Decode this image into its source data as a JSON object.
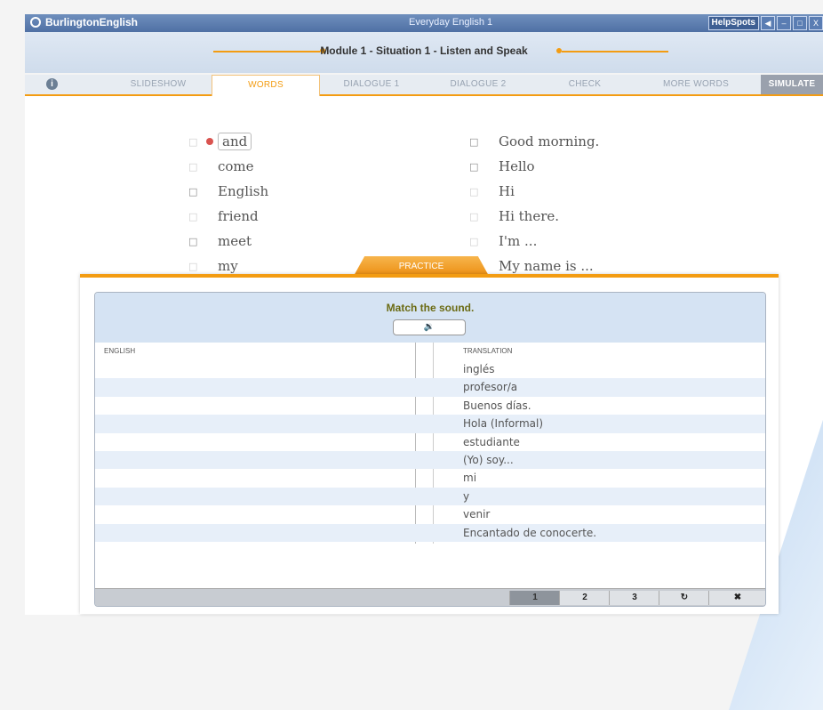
{
  "window": {
    "brand": "BurlingtonEnglish",
    "app_title": "Everyday English 1",
    "helpspots": "HelpSpots",
    "buttons": [
      "◀",
      "–",
      "□",
      "X"
    ]
  },
  "module_title": "Module 1 - Situation 1 - Listen and Speak",
  "tabs": [
    {
      "label": "SLIDESHOW"
    },
    {
      "label": "WORDS"
    },
    {
      "label": "DIALOGUE 1"
    },
    {
      "label": "DIALOGUE 2"
    },
    {
      "label": "CHECK"
    },
    {
      "label": "MORE WORDS"
    },
    {
      "label": "SIMULATE"
    }
  ],
  "words_left": [
    "and",
    "come",
    "English",
    "friend",
    "meet",
    "my"
  ],
  "words_right": [
    "Good morning.",
    "Hello",
    "Hi",
    "Hi there.",
    "I'm ...",
    "My name is ..."
  ],
  "practice": {
    "tab_label": "PRACTICE",
    "instruction": "Match the sound.",
    "sound_button": "🔉",
    "col_english": "ENGLISH",
    "col_translation": "TRANSLATION",
    "translations": [
      "inglés",
      "profesor/a",
      "Buenos días.",
      "Hola (Informal)",
      "estudiante",
      "(Yo) soy...",
      "mi",
      "y",
      "venir",
      "Encantado de conocerte."
    ],
    "pages": [
      "1",
      "2",
      "3"
    ],
    "refresh_icon": "↻",
    "close_icon": "✖"
  }
}
